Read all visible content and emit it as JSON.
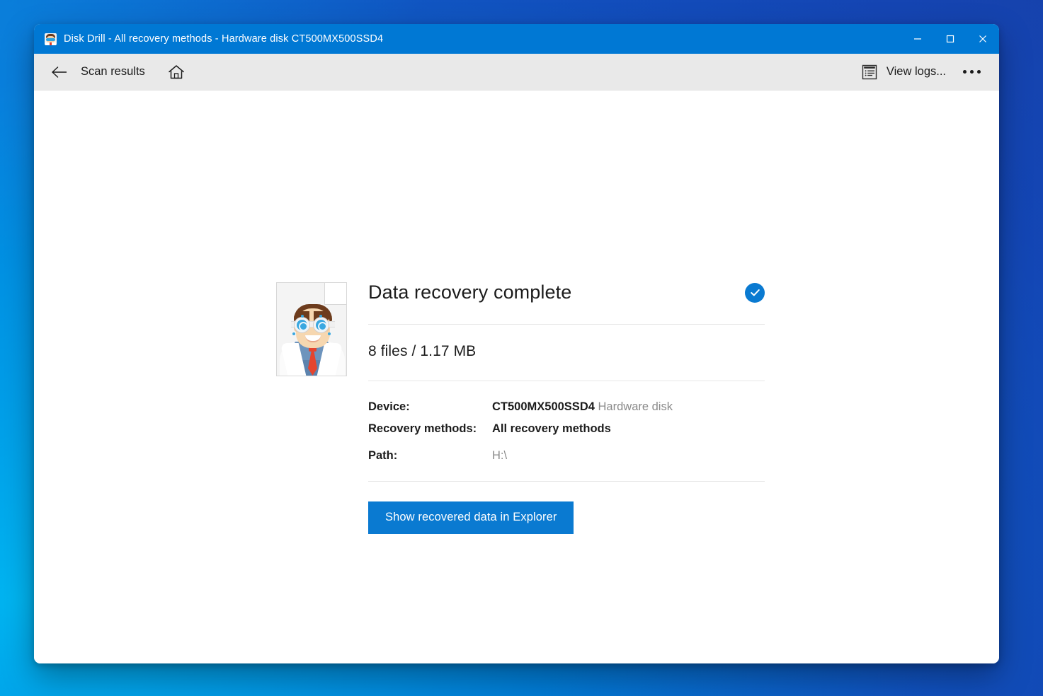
{
  "window": {
    "title": "Disk Drill - All recovery methods - Hardware disk CT500MX500SSD4",
    "app_icon": "disk-drill-avatar-icon",
    "controls": {
      "minimize": "minimize-icon",
      "maximize": "maximize-icon",
      "close": "close-icon"
    }
  },
  "toolbar": {
    "back_icon": "back-arrow-icon",
    "back_label": "Scan results",
    "home_icon": "home-icon",
    "view_logs_icon": "log-list-icon",
    "view_logs_label": "View logs...",
    "more_icon": "more-ellipsis-icon"
  },
  "main": {
    "illustration": "recovered-file-avatar-illustration",
    "title": "Data recovery complete",
    "status_icon": "check-circle-icon",
    "summary": "8 files / 1.17 MB",
    "details": [
      {
        "label": "Device:",
        "value": "CT500MX500SSD4",
        "suffix": "Hardware disk"
      },
      {
        "label": "Recovery methods:",
        "value": "All recovery methods",
        "suffix": ""
      },
      {
        "label": "Path:",
        "value": "H:\\",
        "suffix": ""
      }
    ],
    "primary_button": "Show recovered data in Explorer"
  },
  "colors": {
    "accent": "#0a7ad1",
    "titlebar": "#0078d4",
    "toolbar": "#e9e9e9",
    "text": "#1c1c1c",
    "muted": "#8a8a8a"
  }
}
